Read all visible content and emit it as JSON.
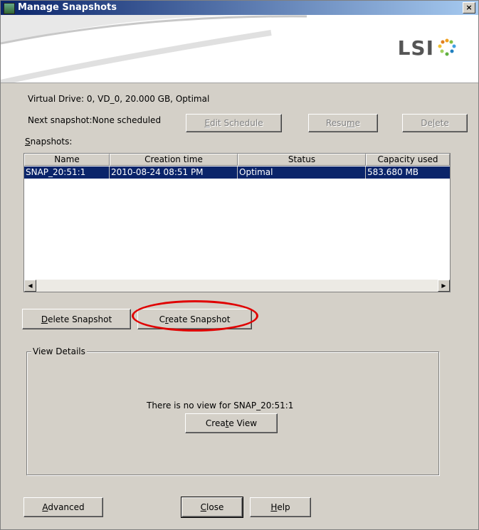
{
  "window": {
    "title": "Manage Snapshots",
    "close_label": "×"
  },
  "banner": {
    "logo_text": "LSI"
  },
  "info": {
    "virtual_drive": "Virtual Drive: 0, VD_0, 20.000 GB, Optimal",
    "next_snapshot": "Next snapshot:None scheduled",
    "snapshots_label_u": "S",
    "snapshots_label_rest": "napshots:"
  },
  "schedule_buttons": {
    "edit": {
      "pre": "",
      "u": "E",
      "post": "dit Schedule"
    },
    "resume": {
      "pre": "Resu",
      "u": "m",
      "post": "e"
    },
    "delete": {
      "pre": "De",
      "u": "l",
      "post": "ete"
    }
  },
  "table": {
    "columns": [
      "Name",
      "Creation time",
      "Status",
      "Capacity used"
    ],
    "rows": [
      {
        "name": "SNAP_20:51:1",
        "creation_time": "2010-08-24 08:51 PM",
        "status": "Optimal",
        "capacity": "583.680 MB"
      }
    ]
  },
  "actions": {
    "delete_snapshot": {
      "pre": "",
      "u": "D",
      "post": "elete Snapshot"
    },
    "create_snapshot": {
      "pre": "C",
      "u": "r",
      "post": "eate Snapshot"
    }
  },
  "view_details": {
    "legend": "View Details",
    "message": "There is no view for SNAP_20:51:1",
    "create_view": {
      "pre": "Crea",
      "u": "t",
      "post": "e View"
    }
  },
  "footer": {
    "advanced": {
      "pre": "",
      "u": "A",
      "post": "dvanced"
    },
    "close": {
      "pre": "",
      "u": "C",
      "post": "lose"
    },
    "help": {
      "pre": "",
      "u": "H",
      "post": "elp"
    }
  },
  "colors": {
    "selection": "#0a246a",
    "highlight_ring": "#e00000",
    "dialog_bg": "#d4d0c8"
  }
}
